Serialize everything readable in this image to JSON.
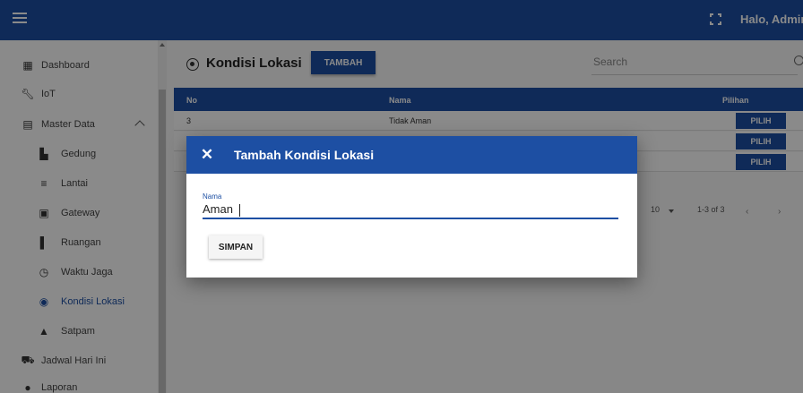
{
  "topbar": {
    "greeting": "Halo, Admin"
  },
  "sidebar": {
    "items": [
      {
        "label": "Dashboard"
      },
      {
        "label": "IoT"
      },
      {
        "label": "Master Data"
      },
      {
        "label": "Gedung"
      },
      {
        "label": "Lantai"
      },
      {
        "label": "Gateway"
      },
      {
        "label": "Ruangan"
      },
      {
        "label": "Waktu Jaga"
      },
      {
        "label": "Kondisi Lokasi"
      },
      {
        "label": "Satpam"
      },
      {
        "label": "Jadwal Hari Ini"
      },
      {
        "label": "Laporan"
      }
    ]
  },
  "main": {
    "title": "Kondisi Lokasi",
    "add_button": "TAMBAH",
    "search_placeholder": "Search",
    "table": {
      "headers": [
        "No",
        "Nama",
        "Pilihan"
      ],
      "rows": [
        {
          "no": "3",
          "nama": "Tidak Aman",
          "action": "PILIH"
        },
        {
          "no": "",
          "nama": "",
          "action": "PILIH"
        },
        {
          "no": "",
          "nama": "",
          "action": "PILIH"
        }
      ]
    },
    "pager": {
      "rows_per_page": "10",
      "range": "1-3 of 3"
    }
  },
  "dialog": {
    "title": "Tambah Kondisi Lokasi",
    "field_label": "Nama",
    "field_value": "Aman",
    "save_button": "SIMPAN"
  },
  "colors": {
    "primary": "#1d4fa3"
  }
}
